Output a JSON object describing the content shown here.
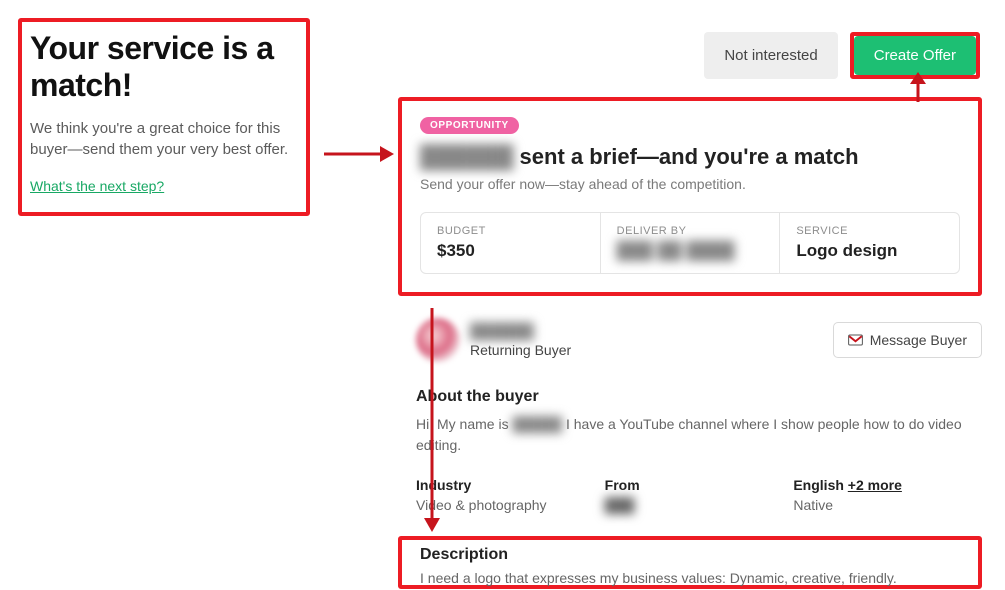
{
  "left": {
    "title": "Your service is a match!",
    "subtitle": "We think you're a great choice for this buyer—send them your very best offer.",
    "next_link": "What's the next step?"
  },
  "actions": {
    "not_interested": "Not interested",
    "create_offer": "Create  Offer"
  },
  "brief": {
    "pill": "OPPORTUNITY",
    "buyer_name_hidden": "██████",
    "title_suffix": "sent a brief—and you're a match",
    "subtitle": "Send your offer now—stay ahead of the competition.",
    "budget_label": "BUDGET",
    "budget_value": "$350",
    "deliver_label": "DELIVER BY",
    "deliver_value_hidden": "███ ██ ████",
    "service_label": "SERVICE",
    "service_value": "Logo design"
  },
  "buyer": {
    "name_hidden": "██████",
    "returning": "Returning Buyer",
    "message_btn": "Message Buyer"
  },
  "about": {
    "title": "About the buyer",
    "text_prefix": "Hi, My name is ",
    "text_name_hidden": "█████",
    "text_suffix": " I have a YouTube channel where I show people how to do video editing."
  },
  "meta": {
    "industry_label": "Industry",
    "industry_value": "Video & photography",
    "from_label": "From",
    "from_value_hidden": "███",
    "lang_label": "English",
    "lang_more": "+2 more",
    "lang_value": "Native"
  },
  "description": {
    "title": "Description",
    "text": "I need a logo that expresses my business values: Dynamic, creative, friendly."
  }
}
